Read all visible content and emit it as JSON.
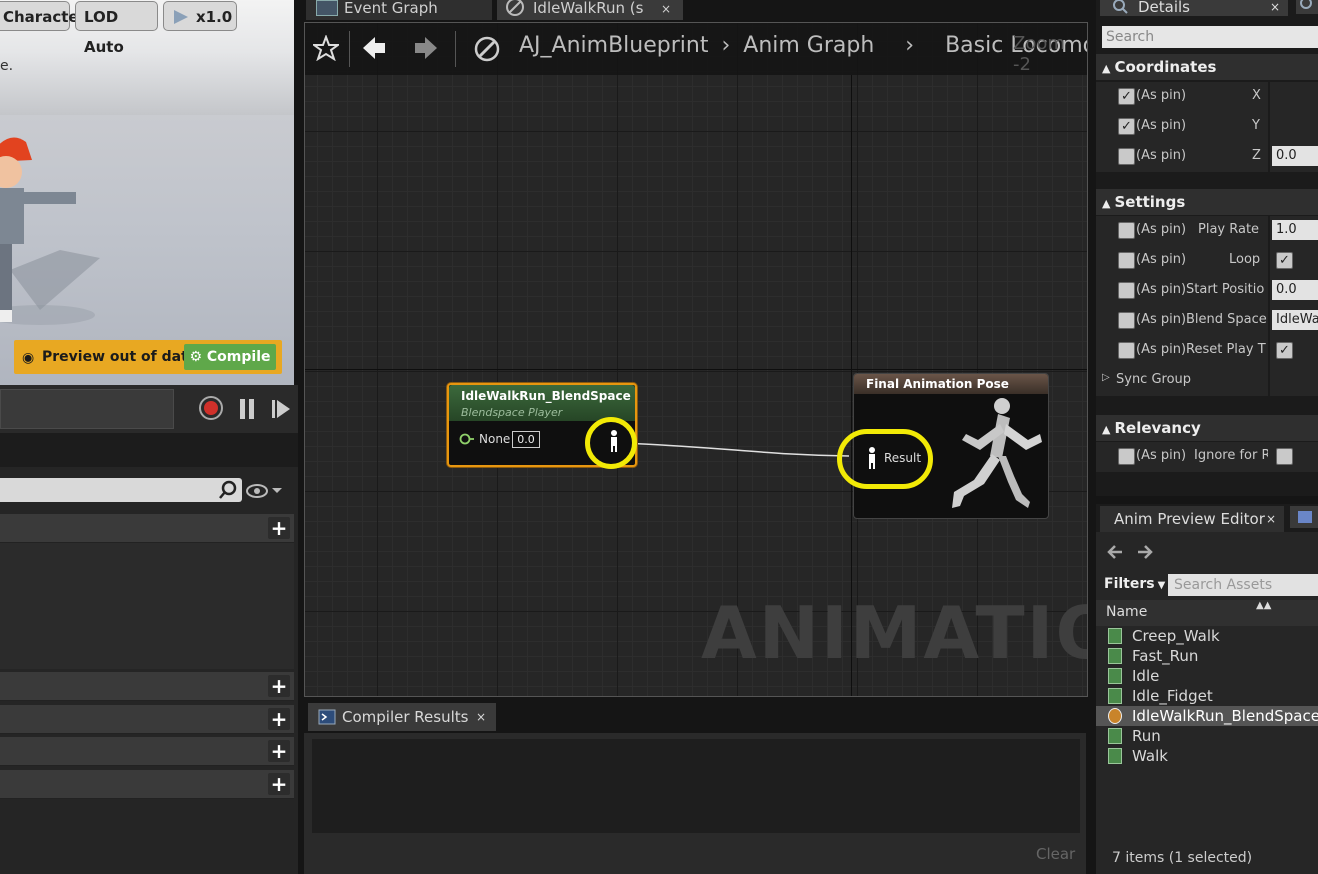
{
  "viewport": {
    "character_btn": "Character",
    "lod_btn": "LOD Auto",
    "speed_btn": "x1.0",
    "message_fragment": "e.",
    "preview_label": "Preview out of date",
    "compile_label": "Compile"
  },
  "tabs": {
    "event_graph": "Event Graph",
    "idlewalkrun": "IdleWalkRun (state",
    "details": "Details"
  },
  "breadcrumb": {
    "blueprint": "AJ_AnimBlueprint",
    "anim_graph": "Anim Graph",
    "basic": "Basic Locomo",
    "zoom": "Zoom -2"
  },
  "graph": {
    "watermark": "ANIMATION",
    "blendspace_node": {
      "title": "IdleWalkRun_BlendSpace",
      "subtitle": "Blendspace Player",
      "pin_label": "None",
      "pin_value": "0.0"
    },
    "final_pose_node": {
      "title": "Final Animation Pose",
      "pin_label": "Result"
    },
    "highlight_color": "#f2ea06"
  },
  "compiler": {
    "tab": "Compiler Results",
    "clear": "Clear"
  },
  "details": {
    "search_placeholder": "Search",
    "coordinates": {
      "title": "Coordinates",
      "rows": [
        {
          "pin": "(As pin)",
          "label": "X",
          "checked": true,
          "value": ""
        },
        {
          "pin": "(As pin)",
          "label": "Y",
          "checked": true,
          "value": ""
        },
        {
          "pin": "(As pin)",
          "label": "Z",
          "checked": false,
          "value": "0.0"
        }
      ]
    },
    "settings": {
      "title": "Settings",
      "rows": [
        {
          "pin": "(As pin)",
          "label": "Play Rate",
          "value": "1.0"
        },
        {
          "pin": "(As pin)",
          "label": "Loop",
          "value": "✓"
        },
        {
          "pin": "(As pin)",
          "label": "Start Positio",
          "value": "0.0"
        },
        {
          "pin": "(As pin)",
          "label": "Blend Space",
          "value": "IdleWa"
        },
        {
          "pin": "(As pin)",
          "label": "Reset Play T",
          "value": "✓"
        }
      ],
      "sync_group": "Sync Group"
    },
    "relevancy": {
      "title": "Relevancy",
      "row": {
        "pin": "(As pin)",
        "label": "Ignore for R"
      }
    }
  },
  "preview_editor": {
    "tab": "Anim Preview Editor",
    "filters": "Filters",
    "search_placeholder": "Search Assets",
    "name_header": "Name",
    "assets": [
      "Creep_Walk",
      "Fast_Run",
      "Idle",
      "Idle_Fidget",
      "IdleWalkRun_BlendSpace",
      "Run",
      "Walk"
    ],
    "selected_index": 4,
    "status": "7 items (1 selected)"
  }
}
